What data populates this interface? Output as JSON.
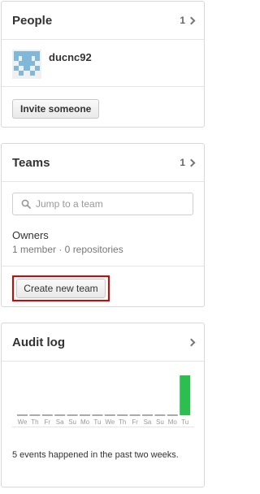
{
  "people": {
    "title": "People",
    "count": "1",
    "member_name": "ducnc92",
    "invite_label": "Invite someone"
  },
  "teams": {
    "title": "Teams",
    "count": "1",
    "search_placeholder": "Jump to a team",
    "team_name": "Owners",
    "team_meta": "1 member · 0 repositories",
    "create_label": "Create new team"
  },
  "audit": {
    "title": "Audit log",
    "description": "5 events happened in the past two weeks."
  },
  "colors": {
    "bar": "#2cbe4e",
    "highlight": "#e00000"
  },
  "chart_data": {
    "type": "bar",
    "categories": [
      "We",
      "Th",
      "Fr",
      "Sa",
      "Su",
      "Mo",
      "Tu",
      "We",
      "Th",
      "Fr",
      "Sa",
      "Su",
      "Mo",
      "Tu"
    ],
    "values": [
      0,
      0,
      0,
      0,
      0,
      0,
      0,
      0,
      0,
      0,
      0,
      0,
      0,
      5
    ],
    "title": "",
    "xlabel": "",
    "ylabel": "",
    "ylim": [
      0,
      5
    ],
    "grid": false
  }
}
